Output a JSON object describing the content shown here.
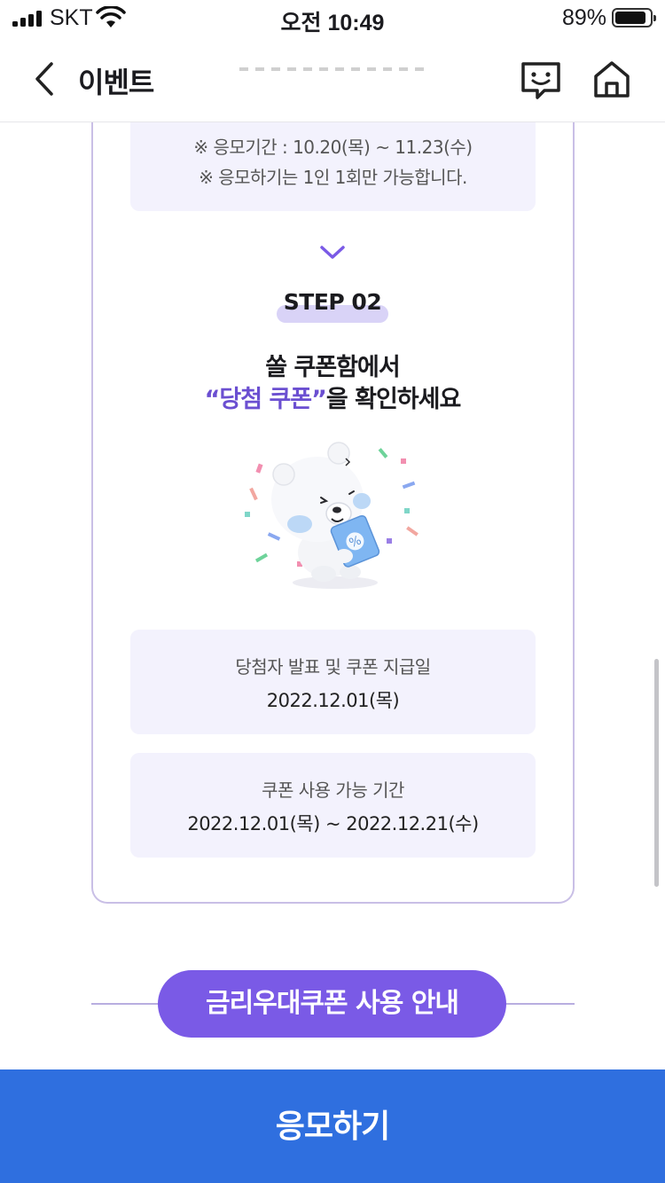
{
  "status_bar": {
    "carrier": "SKT",
    "time": "오전 10:49",
    "battery_percent": "89%",
    "battery_level": 0.89
  },
  "nav": {
    "title": "이벤트"
  },
  "notice": {
    "period": "※ 응모기간 : 10.20(목) ~ 11.23(수)",
    "limit": "※ 응모하기는 1인 1회만 가능합니다."
  },
  "step": {
    "label": "STEP 02",
    "headline_line1": "쏠 쿠폰함에서",
    "headline_accent": "“당첨 쿠폰”",
    "headline_rest": "을 확인하세요"
  },
  "announcement": {
    "label": "당첨자 발표 및 쿠폰 지급일",
    "value": "2022.12.01(목)"
  },
  "usage_period": {
    "label": "쿠폰 사용 가능 기간",
    "value": "2022.12.01(목) ~ 2022.12.21(수)"
  },
  "guide_button": "금리우대쿠폰 사용 안내",
  "apply_button": "응모하기",
  "colors": {
    "accent_purple": "#7a5ae6",
    "apply_blue": "#2f6fdf",
    "box_bg": "#f3f2fd"
  }
}
